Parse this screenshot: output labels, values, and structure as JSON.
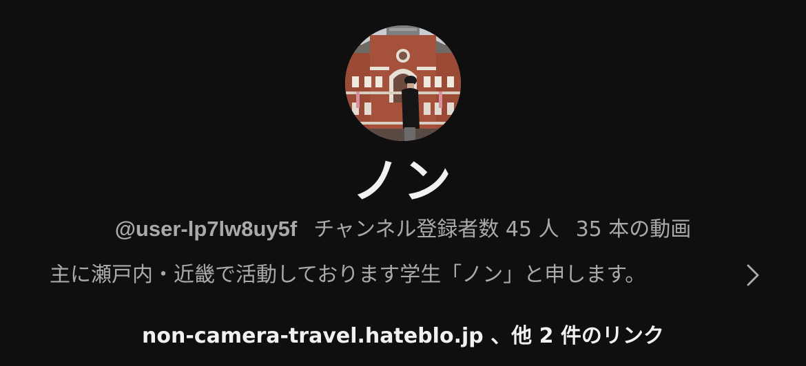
{
  "channel": {
    "name": "ノン",
    "handle": "@user-lp7lw8uy5f",
    "subscribers": "チャンネル登録者数 45 人",
    "video_count": "35 本の動画",
    "description": "主に瀬戸内・近畿で活動しております学生「ノン」と申します。",
    "links_text": "non-camera-travel.hateblo.jp 、他 2 件のリンク"
  },
  "icons": {
    "description_expand": "chevron-right-icon"
  },
  "colors": {
    "background": "#0f0f0f",
    "primary_text": "#f1f1f1",
    "secondary_text": "#aaaaaa"
  }
}
